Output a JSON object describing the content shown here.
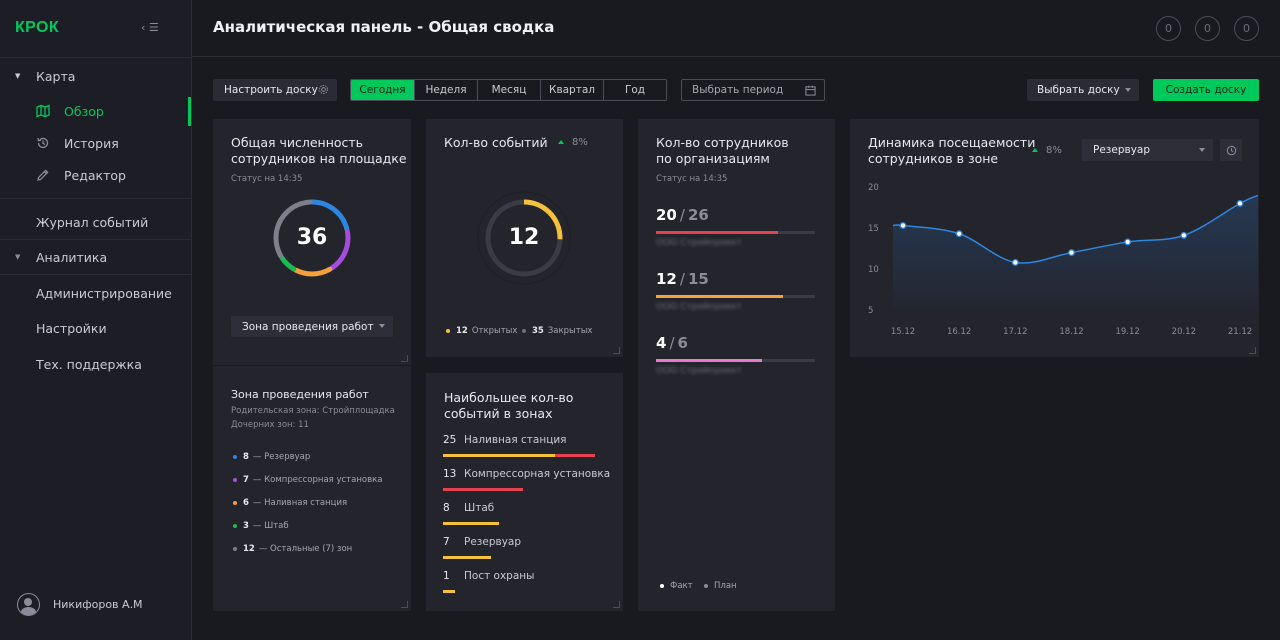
{
  "sidebar": {
    "logo": "КРОК",
    "collapse": "‹ ☰",
    "items": [
      {
        "label": "Карта"
      },
      {
        "label": "Обзор",
        "icon": "map-icon"
      },
      {
        "label": "История",
        "icon": "history-icon"
      },
      {
        "label": "Редактор",
        "icon": "pencil-icon"
      },
      {
        "label": "Журнал событий"
      },
      {
        "label": "Аналитика"
      },
      {
        "label": "Администрирование"
      },
      {
        "label": "Настройки"
      },
      {
        "label": "Тех. поддержка"
      }
    ],
    "user_name": "Никифоров А.М"
  },
  "header": {
    "title": "Аналитическая панель - Общая сводка",
    "buttons": [
      "0",
      "0",
      "0"
    ]
  },
  "toolbar": {
    "configure": "Настроить доску",
    "periods": [
      "Сегодня",
      "Неделя",
      "Месяц",
      "Квартал",
      "Год"
    ],
    "period_placeholder": "Выбрать период",
    "select_board": "Выбрать доску",
    "create_board": "Создать доску"
  },
  "colors": {
    "accent": "#00c95c",
    "blue": "#2f86e0",
    "purple": "#a64dde",
    "orange": "#f5a03a",
    "green": "#1db954",
    "gray": "#7d7f8a",
    "yellow": "#f5c13a",
    "red": "#e5404f",
    "pink": "#e37cc8"
  },
  "workers_card": {
    "title_line1": "Общая численность",
    "title_line2": "сотрудников на площадке",
    "status": "Статус на 14:35",
    "total": "36",
    "segments": [
      {
        "value": 8,
        "color": "#2f86e0"
      },
      {
        "value": 7,
        "color": "#a64dde"
      },
      {
        "value": 6,
        "color": "#f5a03a"
      },
      {
        "value": 3,
        "color": "#1db954"
      },
      {
        "value": 12,
        "color": "#7d7f8a"
      }
    ],
    "zone_select": "Зона проведения работ"
  },
  "zone_card": {
    "title": "Зона проведения работ",
    "parent": "Родительская зона: Стройплощадка",
    "children": "Дочерних зон: 11",
    "items": [
      {
        "count": "8",
        "label": "— Резервуар",
        "color": "#2f86e0"
      },
      {
        "count": "7",
        "label": "— Компрессорная установка",
        "color": "#a64dde"
      },
      {
        "count": "6",
        "label": "— Наливная станция",
        "color": "#f5a03a"
      },
      {
        "count": "3",
        "label": "— Штаб",
        "color": "#1db954"
      },
      {
        "count": "12",
        "label": "— Остальные (7) зон",
        "color": "#7d7f8a"
      }
    ]
  },
  "events_card": {
    "title": "Кол-во событий",
    "trend": "8%",
    "total": "12",
    "open_value": 12,
    "closed_value": 35,
    "open_count": "12",
    "open_label": "Открытых",
    "closed_count": "35",
    "closed_label": "Закрытых"
  },
  "top_zones_card": {
    "title_line1": "Наибольшее кол-во",
    "title_line2": "событий в зонах",
    "items": [
      {
        "count": "25",
        "label": "Наливная станция",
        "yellow": 14,
        "red": 5
      },
      {
        "count": "13",
        "label": "Компрессорная установка",
        "yellow": 0,
        "red": 10
      },
      {
        "count": "8",
        "label": "Штаб",
        "yellow": 7,
        "red": 0
      },
      {
        "count": "7",
        "label": "Резервуар",
        "yellow": 6,
        "red": 0
      },
      {
        "count": "1",
        "label": "Пост охраны",
        "yellow": 1.5,
        "red": 0
      }
    ]
  },
  "orgs_card": {
    "title_line1": "Кол-во сотрудников",
    "title_line2": "по организациям",
    "status": "Статус на 14:35",
    "orgs": [
      {
        "fact": "20",
        "plan": "26",
        "name": "ООО Стройпроект",
        "color": "#e5404f"
      },
      {
        "fact": "12",
        "plan": "15",
        "name": "ООО Стройпроект",
        "color": "#f5a03a"
      },
      {
        "fact": "4",
        "plan": "6",
        "name": "ООО Стройпроект",
        "color": "#e37cc8"
      }
    ],
    "legend_fact": "Факт",
    "legend_plan": "План"
  },
  "dynamics_card": {
    "title_line1": "Динамика посещаемости",
    "title_line2": "сотрудников в зоне",
    "trend": "8%",
    "zone_select": "Резервуар"
  },
  "chart_data": {
    "type": "line",
    "title": "Динамика посещаемости сотрудников в зоне",
    "x": [
      "15.12",
      "16.12",
      "17.12",
      "18.12",
      "19.12",
      "20.12",
      "21.12"
    ],
    "series": [
      {
        "values": [
          15.3,
          14.3,
          10.8,
          12.0,
          13.3,
          14.1,
          18.0
        ]
      }
    ],
    "yticks": [
      5,
      10,
      15,
      20
    ],
    "ylim": [
      5,
      20
    ],
    "grid": false,
    "legend": "none"
  }
}
